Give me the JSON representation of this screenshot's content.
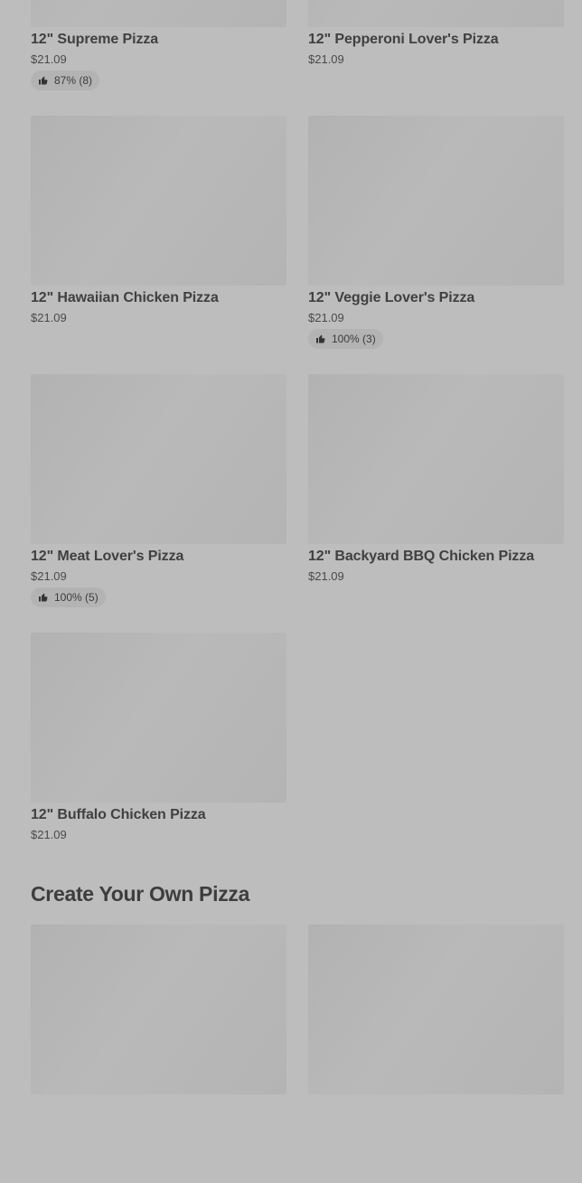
{
  "products": [
    {
      "name": "12\" Supreme Pizza",
      "price": "$21.09",
      "rating": "87% (8)"
    },
    {
      "name": "12\" Pepperoni Lover's Pizza",
      "price": "$21.09",
      "rating": ""
    },
    {
      "name": "12\" Hawaiian Chicken Pizza",
      "price": "$21.09",
      "rating": ""
    },
    {
      "name": "12\" Veggie Lover's Pizza",
      "price": "$21.09",
      "rating": "100% (3)"
    },
    {
      "name": "12\" Meat Lover's Pizza",
      "price": "$21.09",
      "rating": "100% (5)"
    },
    {
      "name": "12\" Backyard BBQ Chicken Pizza",
      "price": "$21.09",
      "rating": ""
    },
    {
      "name": "12\" Buffalo Chicken Pizza",
      "price": "$21.09",
      "rating": ""
    }
  ],
  "section_create": {
    "title": "Create Your Own Pizza"
  },
  "icons": {
    "rating": "thumbs-up-icon"
  },
  "colors": {
    "background": "#bdbdbd",
    "image_placeholder": "#b6b6b6",
    "rating_pill": "#b3b3b3",
    "text": "#3a3a3a"
  }
}
